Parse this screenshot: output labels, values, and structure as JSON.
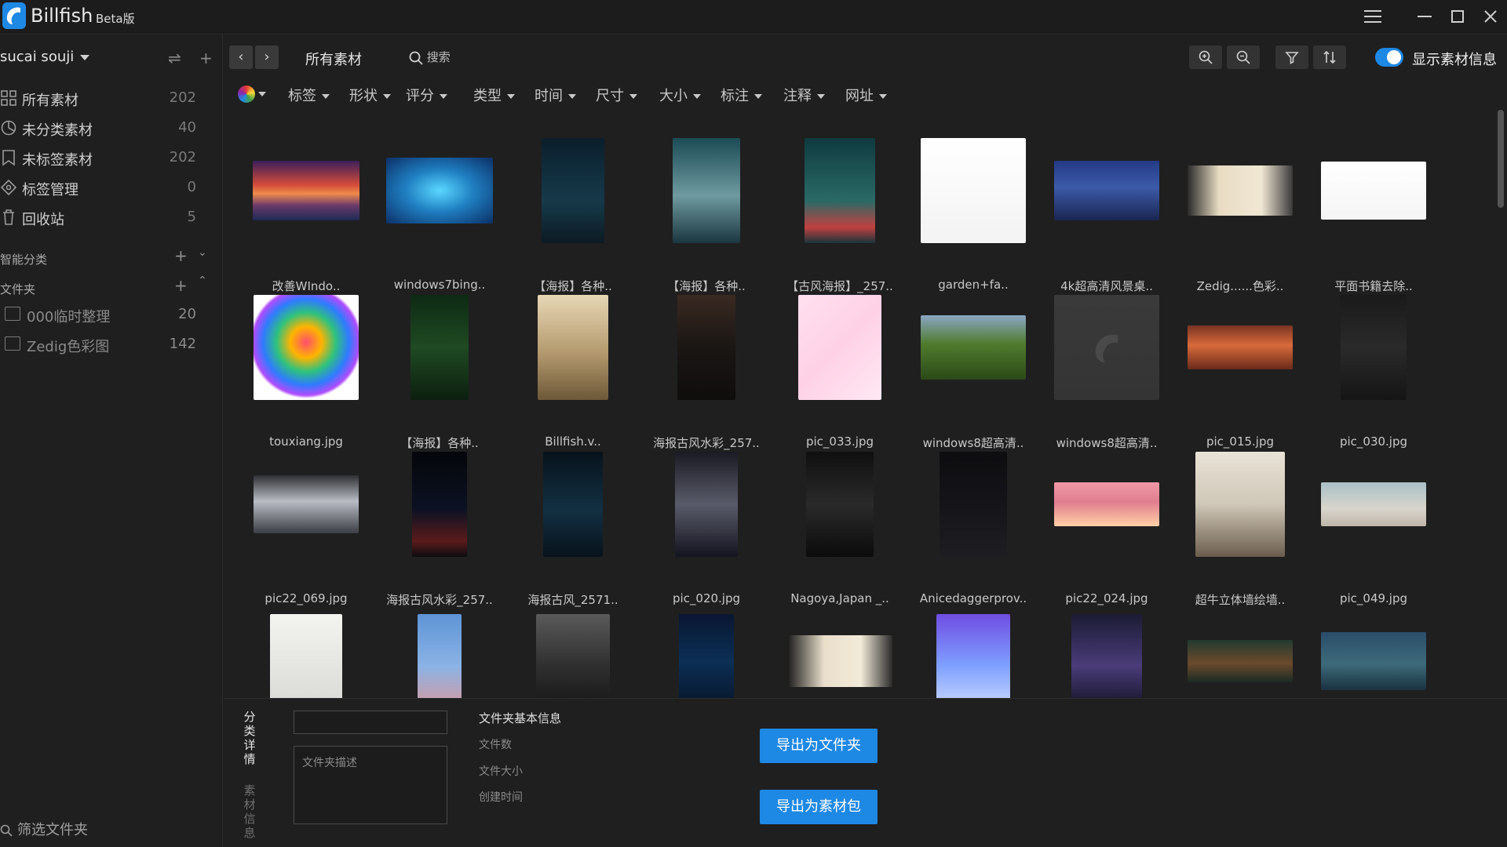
{
  "app": {
    "name": "Billfish",
    "badge": "Beta版"
  },
  "sidebar": {
    "library": "sucai souji",
    "nav": [
      {
        "label": "所有素材",
        "count": "202",
        "icon": "grid-icon"
      },
      {
        "label": "未分类素材",
        "count": "40",
        "icon": "pie-icon"
      },
      {
        "label": "未标签素材",
        "count": "202",
        "icon": "tag-icon"
      },
      {
        "label": "标签管理",
        "count": "0",
        "icon": "tag-manage-icon"
      },
      {
        "label": "回收站",
        "count": "5",
        "icon": "trash-icon"
      }
    ],
    "smart_title": "智能分类",
    "folder_title": "文件夹",
    "folders": [
      {
        "label": "000临时整理",
        "count": "20"
      },
      {
        "label": "Zedig色彩图",
        "count": "142"
      }
    ],
    "filter_folders": "筛选文件夹"
  },
  "toolbar": {
    "breadcrumb": "所有素材",
    "search_placeholder": "搜索",
    "show_info_label": "显示素材信息"
  },
  "filters": [
    "标签",
    "形状",
    "评分",
    "类型",
    "时间",
    "尺寸",
    "大小",
    "标注",
    "注释",
    "网址"
  ],
  "items": [
    {
      "name": "改善WIndo..",
      "bg": "linear-gradient(180deg,#3a1f5a 0%,#d24a3a 40%,#f08a4b 55%,#6a3a6a 75%,#1d2a55 100%)"
    },
    {
      "name": "windows7bing..",
      "bg": "radial-gradient(ellipse at 50% 50%,#5ad8ff 0%,#1f7fc2 45%,#0c2f66 100%)"
    },
    {
      "name": "【海报】各种..",
      "bg": "linear-gradient(180deg,#0b1e2c 0%,#163a4a 60%,#0c1a22 100%)"
    },
    {
      "name": "【海报】各种..",
      "bg": "linear-gradient(180deg,#1b4b55 0%,#6f9aa0 55%,#1b3640 100%)"
    },
    {
      "name": "【古风海报】_257..",
      "bg": "linear-gradient(180deg,#0f3a3f 0%,#2a6a66 60%,#c04040 85%,#18343a 100%)"
    },
    {
      "name": "garden+fa..",
      "bg": "linear-gradient(180deg,#ffffff 0%,#f3f3f3 100%)"
    },
    {
      "name": "4k超高清风景桌..",
      "bg": "linear-gradient(180deg,#243a86 0%,#3c5aa8 45%,#1a2550 100%)"
    },
    {
      "name": "Zedig......色彩..",
      "bg": "linear-gradient(90deg,#2a2a2a 0%,#e8dcc3 30%,#f1e7d4 70%,#3a3a3a 100%)"
    },
    {
      "name": "平面书籍去除..",
      "bg": "linear-gradient(180deg,#ffffff 0%,#f5f5f5 100%)"
    },
    {
      "name": "touxiang.jpg",
      "bg": "radial-gradient(circle at 50% 45%,#ff4d6d 0%,#ffb400 20%,#2ec27e 38%,#2f7bff 55%,#b04cff 68%,#ffffff 72%)"
    },
    {
      "name": "【海报】各种..",
      "bg": "linear-gradient(180deg,#0d2a14 0%,#1f4a22 50%,#0c1f10 100%)"
    },
    {
      "name": "Billfish.v..",
      "bg": "linear-gradient(180deg,#e7d7b5 0%,#b49a6e 55%,#6d5838 100%)"
    },
    {
      "name": "海报古风水彩_257..",
      "bg": "linear-gradient(180deg,#3a2a22 0%,#1a1614 50%,#0f0d0c 100%)"
    },
    {
      "name": "pic_033.jpg",
      "bg": "linear-gradient(135deg,#ffe0ef 0%,#ffd1e6 50%,#ffe9f3 100%)"
    },
    {
      "name": "windows8超高清..",
      "bg": "linear-gradient(180deg,#8aa6c2 0%,#4f7b2d 45%,#2c4a18 100%)"
    },
    {
      "name": "windows8超高清..",
      "bg": "linear-gradient(180deg,#3a3a3a 0%,#343434 100%)"
    },
    {
      "name": "pic_015.jpg",
      "bg": "linear-gradient(180deg,#7a3322 0%,#d86a3b 45%,#6a2a1a 100%)"
    },
    {
      "name": "pic_030.jpg",
      "bg": "linear-gradient(180deg,#1a1a1a 0%,#2a2a2a 50%,#151515 100%)"
    },
    {
      "name": "pic22_069.jpg",
      "bg": "linear-gradient(180deg,#2d2f33 0%,#b9bcc4 45%,#3b3d44 100%)"
    },
    {
      "name": "海报古风水彩_257..",
      "bg": "linear-gradient(180deg,#05060a 0%,#0c1224 55%,#5b1b1b 85%,#0b0c10 100%)"
    },
    {
      "name": "海报古风_2571..",
      "bg": "linear-gradient(180deg,#07121a 0%,#123043 55%,#08121a 100%)"
    },
    {
      "name": "pic_020.jpg",
      "bg": "linear-gradient(180deg,#1a1a24 0%,#5a5b6a 50%,#141420 100%)"
    },
    {
      "name": "Nagoya,Japan _..",
      "bg": "linear-gradient(180deg,#0f0f10 0%,#2a2a2a 50%,#0b0b0b 100%)"
    },
    {
      "name": "Anicedaggerprov..",
      "bg": "linear-gradient(180deg,#0d0d10 0%,#1d1d22 100%)"
    },
    {
      "name": "pic22_024.jpg",
      "bg": "linear-gradient(180deg,#f09aa7 0%,#e07d8f 45%,#ffd1a6 100%)"
    },
    {
      "name": "超牛立体墙绘墙..",
      "bg": "linear-gradient(180deg,#e9e3d7 0%,#cfc7b7 50%,#6b5d4d 100%)"
    },
    {
      "name": "pic_049.jpg",
      "bg": "linear-gradient(180deg,#a8c0c7 0%,#d9d5cc 60%,#bfb6aa 100%)"
    },
    {
      "name": "",
      "bg": "linear-gradient(180deg,#f3f3f0 0%,#d9d9d6 100%)"
    },
    {
      "name": "",
      "bg": "linear-gradient(180deg,#5e94d6 0%,#8ab3e6 55%,#d79aa1 100%)"
    },
    {
      "name": "",
      "bg": "linear-gradient(180deg,#5a5a5a 0%,#2f2f2f 55%,#171717 100%)"
    },
    {
      "name": "",
      "bg": "linear-gradient(180deg,#0a1632 0%,#0b2f55 50%,#081529 100%)"
    },
    {
      "name": "",
      "bg": "linear-gradient(90deg,#1a1a1a 0%,#e9dfcb 35%,#f2ead8 70%,#2a2a2a 100%)"
    },
    {
      "name": "",
      "bg": "linear-gradient(180deg,#6f4de3 0%,#7ea0ff 55%,#cad6ff 100%)"
    },
    {
      "name": "",
      "bg": "linear-gradient(180deg,#1b1b33 0%,#4a3c7a 55%,#131326 100%)"
    },
    {
      "name": "",
      "bg": "linear-gradient(180deg,#223a30 0%,#6b4a2c 55%,#1a2a24 100%)"
    },
    {
      "name": "",
      "bg": "linear-gradient(180deg,#2a4d6a 0%,#3d6a7a 55%,#1a3140 100%)"
    }
  ],
  "bottom_panel": {
    "tab_category": "分类详情",
    "tab_asset": "素材信息",
    "desc_placeholder": "文件夹描述",
    "info_title": "文件夹基本信息",
    "file_count": "文件数",
    "file_size": "文件大小",
    "created": "创建时间",
    "export_folder": "导出为文件夹",
    "export_pack": "导出为素材包"
  }
}
